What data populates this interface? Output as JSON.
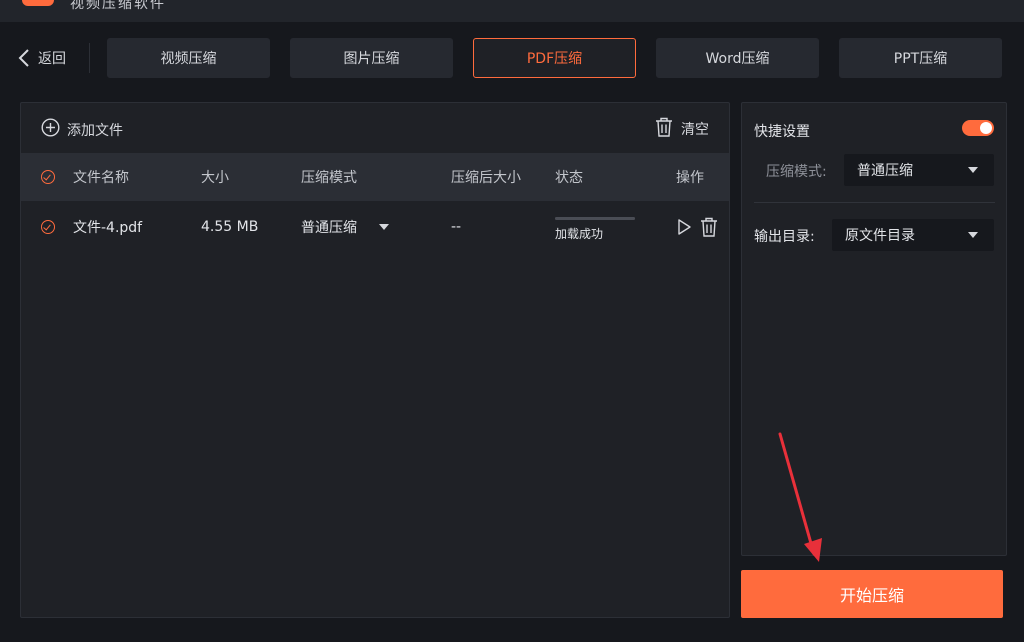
{
  "header": {
    "title": "视频压缩软件"
  },
  "nav": {
    "back_label": "返回",
    "tabs": [
      {
        "label": "视频压缩"
      },
      {
        "label": "图片压缩"
      },
      {
        "label": "PDF压缩"
      },
      {
        "label": "Word压缩"
      },
      {
        "label": "PPT压缩"
      }
    ],
    "active_tab": "PDF压缩"
  },
  "file_panel": {
    "add_file_label": "添加文件",
    "clear_label": "清空",
    "columns": {
      "name": "文件名称",
      "size": "大小",
      "mode": "压缩模式",
      "after_size": "压缩后大小",
      "status": "状态",
      "ops": "操作"
    },
    "rows": [
      {
        "name": "文件-4.pdf",
        "size": "4.55 MB",
        "mode": "普通压缩",
        "after_size": "--",
        "status": "加载成功",
        "checked": true
      }
    ]
  },
  "settings": {
    "title": "快捷设置",
    "enabled": true,
    "mode_label": "压缩模式:",
    "mode_value": "普通压缩",
    "output_label": "输出目录:",
    "output_value": "原文件目录"
  },
  "start_button_label": "开始压缩",
  "colors": {
    "accent": "#ff6b3d",
    "background": "#16181d",
    "panel": "#1f2126",
    "annotation_arrow": "#e8303a"
  },
  "icons": {
    "back": "chevron-left-icon",
    "add": "plus-circle-icon",
    "clear": "trash-icon",
    "check": "check-circle-icon",
    "dropdown": "caret-down-icon",
    "play": "play-icon",
    "delete": "trash-icon"
  }
}
